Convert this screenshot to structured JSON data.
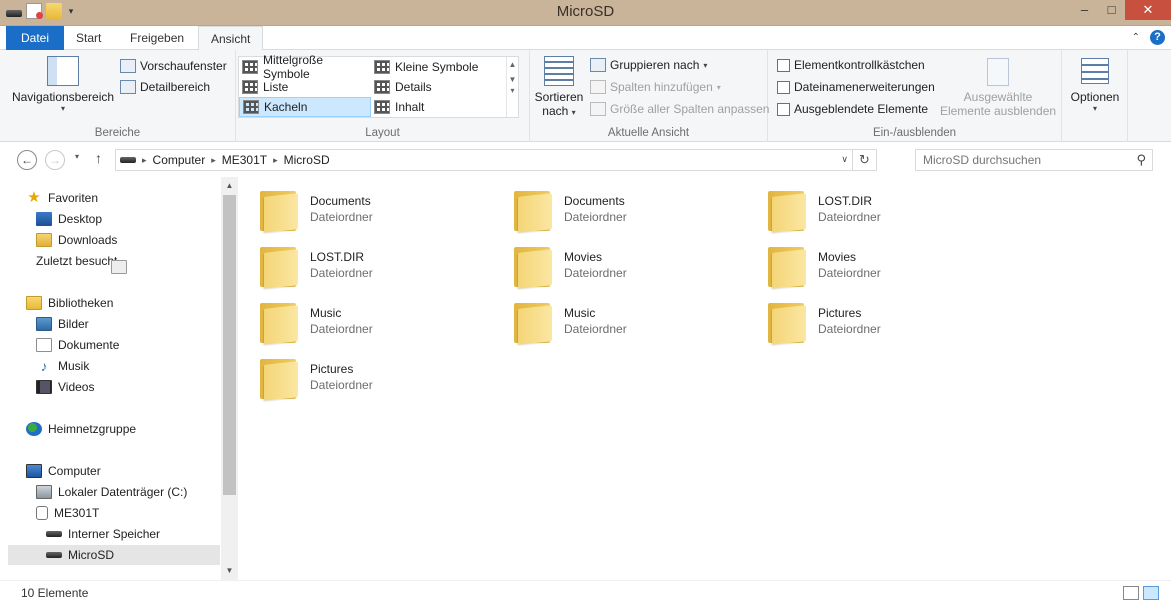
{
  "window": {
    "title": "MicroSD"
  },
  "quick_access": {
    "icons": [
      "drive-icon",
      "properties-icon",
      "new-folder-icon",
      "customize-arrow-icon"
    ]
  },
  "ribbon_tabs": [
    {
      "label": "Datei"
    },
    {
      "label": "Start"
    },
    {
      "label": "Freigeben"
    },
    {
      "label": "Ansicht"
    }
  ],
  "ribbon": {
    "bereiche": {
      "label": "Bereiche",
      "nav_pane": "Navigationsbereich",
      "preview": "Vorschaufenster",
      "details": "Detailbereich"
    },
    "layout": {
      "label": "Layout",
      "items": [
        "Mittelgroße Symbole",
        "Kleine Symbole",
        "Liste",
        "Details",
        "Kacheln",
        "Inhalt"
      ],
      "selected": "Kacheln"
    },
    "aktuelle_ansicht": {
      "label": "Aktuelle Ansicht",
      "sort_line1": "Sortieren",
      "sort_line2": "nach",
      "group_by": "Gruppieren nach",
      "add_columns": "Spalten hinzufügen",
      "fit_columns": "Größe aller Spalten anpassen"
    },
    "ein_ausblenden": {
      "label": "Ein-/ausblenden",
      "checkboxes": [
        "Elementkontrollkästchen",
        "Dateinamenerweiterungen",
        "Ausgeblendete Elemente"
      ],
      "hide_selected_line1": "Ausgewählte",
      "hide_selected_line2": "Elemente ausblenden"
    },
    "optionen": {
      "label": "Optionen"
    }
  },
  "address_bar": {
    "crumbs": [
      "Computer",
      "ME301T",
      "MicroSD"
    ],
    "search_placeholder": "MicroSD durchsuchen"
  },
  "nav_tree": [
    {
      "label": "Favoriten",
      "icon": "star-icon"
    },
    {
      "label": "Desktop",
      "icon": "desktop-icon"
    },
    {
      "label": "Downloads",
      "icon": "downloads-icon"
    },
    {
      "label": "Zuletzt besucht",
      "icon": "recent-places-icon"
    },
    {
      "label": "Bibliotheken",
      "icon": "libraries-icon"
    },
    {
      "label": "Bilder",
      "icon": "pictures-icon"
    },
    {
      "label": "Dokumente",
      "icon": "documents-icon"
    },
    {
      "label": "Musik",
      "icon": "music-icon"
    },
    {
      "label": "Videos",
      "icon": "videos-icon"
    },
    {
      "label": "Heimnetzgruppe",
      "icon": "homegroup-icon"
    },
    {
      "label": "Computer",
      "icon": "computer-icon"
    },
    {
      "label": "Lokaler Datenträger (C:)",
      "icon": "local-disk-icon"
    },
    {
      "label": "ME301T",
      "icon": "device-icon"
    },
    {
      "label": "Interner Speicher",
      "icon": "storage-icon"
    },
    {
      "label": "MicroSD",
      "icon": "storage-icon",
      "selected": true
    }
  ],
  "files": [
    {
      "name": "Documents",
      "type": "Dateiordner"
    },
    {
      "name": "Documents",
      "type": "Dateiordner"
    },
    {
      "name": "LOST.DIR",
      "type": "Dateiordner"
    },
    {
      "name": "LOST.DIR",
      "type": "Dateiordner"
    },
    {
      "name": "Movies",
      "type": "Dateiordner"
    },
    {
      "name": "Movies",
      "type": "Dateiordner"
    },
    {
      "name": "Music",
      "type": "Dateiordner"
    },
    {
      "name": "Music",
      "type": "Dateiordner"
    },
    {
      "name": "Pictures",
      "type": "Dateiordner"
    },
    {
      "name": "Pictures",
      "type": "Dateiordner"
    }
  ],
  "status": {
    "count": "10 Elemente"
  },
  "colors": {
    "accent": "#1a6ec8",
    "titlebar": "#c9b49a",
    "close": "#c7503f",
    "selection": "#cce8ff"
  }
}
